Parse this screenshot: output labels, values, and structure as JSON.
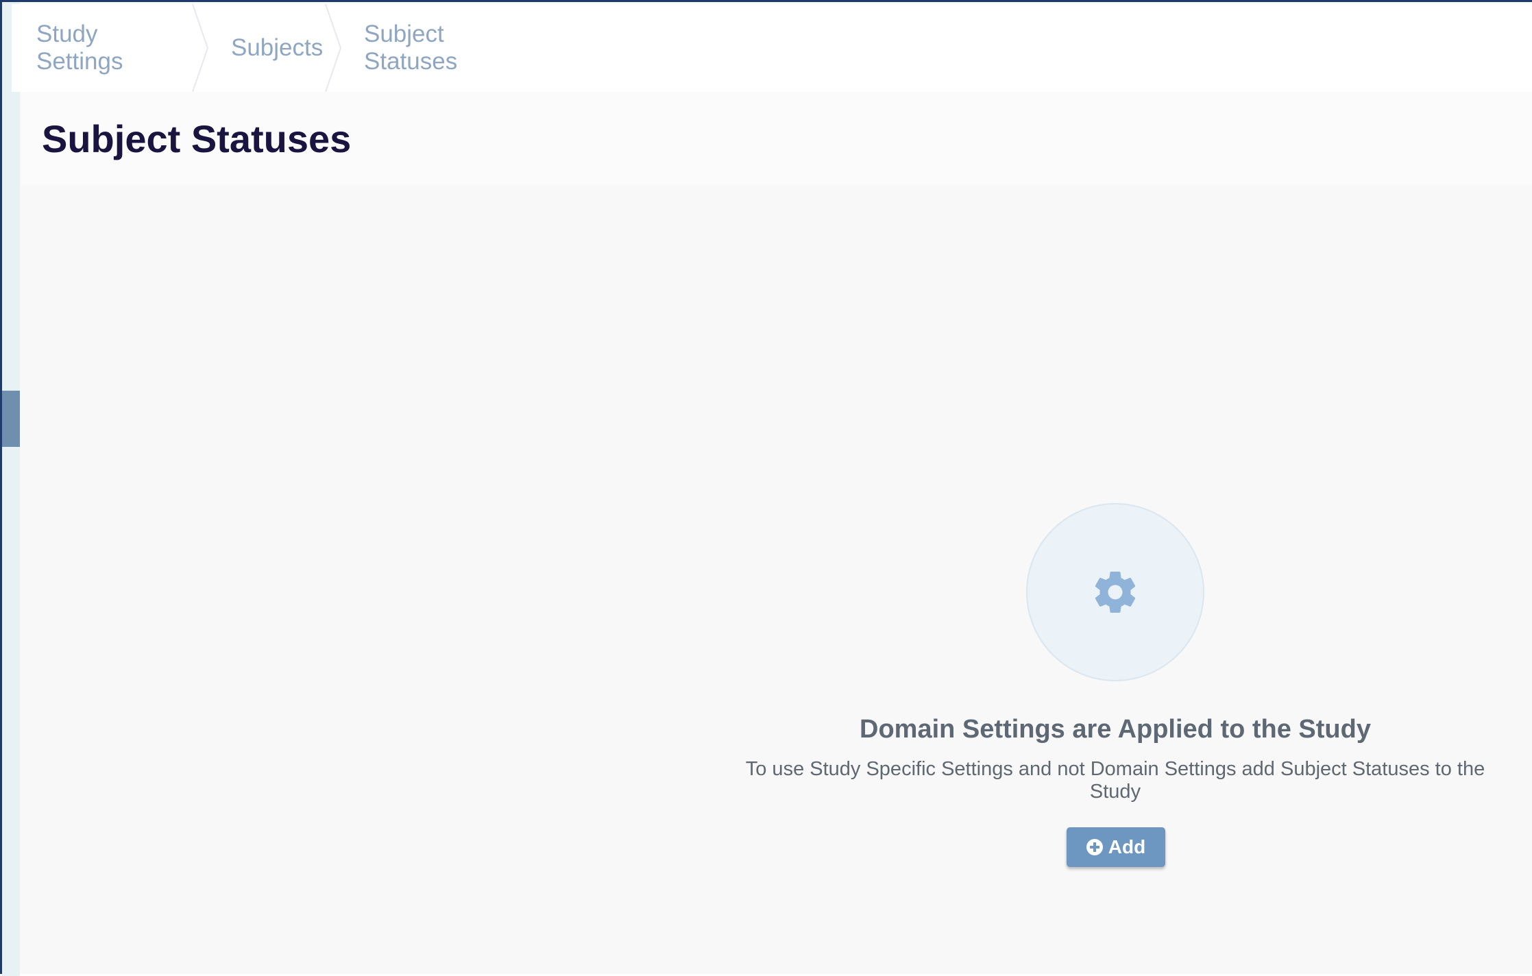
{
  "breadcrumb": {
    "items": [
      {
        "label": "Study Settings"
      },
      {
        "label": "Subjects"
      },
      {
        "label": "Subject Statuses"
      }
    ]
  },
  "page": {
    "title": "Subject Statuses"
  },
  "empty_state": {
    "icon": "gear-icon",
    "title": "Domain Settings are Applied to the Study",
    "message": "To use Study Specific Settings and not Domain Settings add Subject Statuses to the Study",
    "add_label": "Add",
    "add_icon": "plus-circle-icon"
  },
  "colors": {
    "title": "#1a1440",
    "breadcrumb": "#8fa6c2",
    "accent": "#6d96c0",
    "icon": "#8fb3d9"
  }
}
